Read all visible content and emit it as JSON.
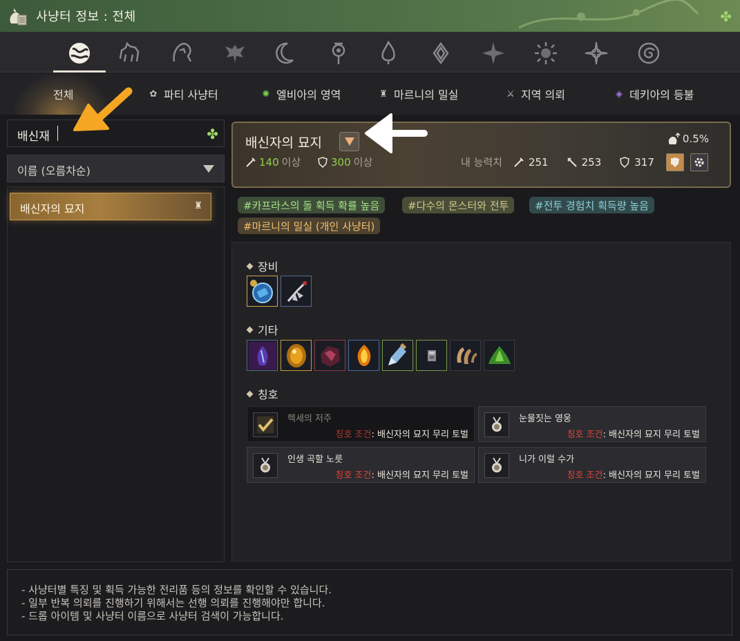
{
  "window": {
    "title": "사냥터 정보 : 전체"
  },
  "categories": [
    {
      "name": "all",
      "icon": "globe-icon",
      "active": true
    },
    {
      "name": "horse",
      "icon": "horse-icon"
    },
    {
      "name": "lion",
      "icon": "lion-icon"
    },
    {
      "name": "eagle",
      "icon": "eagle-icon"
    },
    {
      "name": "moon",
      "icon": "moon-icon"
    },
    {
      "name": "emblem",
      "icon": "emblem-icon"
    },
    {
      "name": "flame",
      "icon": "flame-icon"
    },
    {
      "name": "lotus",
      "icon": "lotus-icon"
    },
    {
      "name": "star",
      "icon": "star-icon"
    },
    {
      "name": "sun",
      "icon": "sun-icon"
    },
    {
      "name": "compass",
      "icon": "compass-icon"
    },
    {
      "name": "spiral",
      "icon": "spiral-icon"
    }
  ],
  "tabs": [
    {
      "label": "전체",
      "icon": ""
    },
    {
      "label": "파티 사냥터",
      "icon": "party-icon"
    },
    {
      "label": "엘비아의 영역",
      "icon": "elvia-icon"
    },
    {
      "label": "마르니의 밀실",
      "icon": "marni-icon"
    },
    {
      "label": "지역 의뢰",
      "icon": "quest-icon"
    },
    {
      "label": "데키아의 등불",
      "icon": "lantern-icon"
    }
  ],
  "search": {
    "value": "배신재"
  },
  "sort": {
    "value": "이름 (오름차순)"
  },
  "list": [
    {
      "label": "배신자의 묘지"
    }
  ],
  "detail": {
    "name": "배신자의 묘지",
    "ap_req": "140",
    "dp_req": "300",
    "req_unit": "이상",
    "drop_rate": "0.5%",
    "my_stats_label": "내 능력치",
    "my_ap": "251",
    "my_aap": "253",
    "my_dp": "317"
  },
  "tags": [
    "#카프라스의 돌 획득 확률 높음",
    "#다수의 몬스터와 전투",
    "#전투 경험치 획득량 높음",
    "#마르니의 밀실 (개인 사냥터)"
  ],
  "sections": {
    "equipment": "장비",
    "misc": "기타",
    "titles": "칭호"
  },
  "titles": [
    {
      "name": "헥세의 저주",
      "cond_label": "칭호 조건",
      "cond": ": 배신자의 묘지  무리 토벌",
      "achieved": true
    },
    {
      "name": "눈물짓는 영웅",
      "cond_label": "칭호 조건",
      "cond": ": 배신자의 묘지  무리 토벌"
    },
    {
      "name": "인생 곡할 노릇",
      "cond_label": "칭호 조건",
      "cond": ": 배신자의 묘지  무리 토벌"
    },
    {
      "name": "니가 이럴 수가",
      "cond_label": "칭호 조건",
      "cond": ": 배신자의 묘지  무리 토벌"
    }
  ],
  "notes": [
    "- 사냥터별 특징 및 획득 가능한 전리품 등의 정보를 확인할 수 있습니다.",
    "- 일부 반복 의뢰를 진행하기 위해서는 선행 의뢰를 진행해야만 합니다.",
    "- 드롭 아이템 및 사냥터 이름으로 사냥터 검색이 가능합니다."
  ],
  "colors": {
    "titlebar": "#4a6b44",
    "accent_green": "#8fd24a",
    "condition_red": "#e04038",
    "annotation_orange": "#f5a623",
    "annotation_white": "#ffffff"
  }
}
